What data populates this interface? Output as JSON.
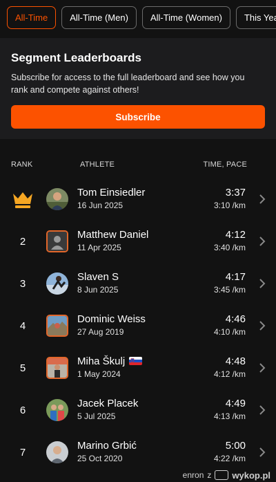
{
  "tabs": [
    {
      "label": "All-Time",
      "active": true
    },
    {
      "label": "All-Time (Men)",
      "active": false
    },
    {
      "label": "All-Time (Women)",
      "active": false
    },
    {
      "label": "This Year",
      "active": false
    }
  ],
  "promo": {
    "title": "Segment Leaderboards",
    "text": "Subscribe for access to the full leaderboard and see how you rank and compete against others!",
    "button_label": "Subscribe"
  },
  "leaderboard": {
    "headers": {
      "rank": "RANK",
      "athlete": "ATHLETE",
      "time": "TIME, PACE"
    },
    "rows": [
      {
        "rank": "1",
        "rank_icon": "crown-icon",
        "name": "Tom Einsiedler",
        "flag": "",
        "date": "16 Jun 2025",
        "time": "3:37",
        "pace": "3:10 /km"
      },
      {
        "rank": "2",
        "name": "Matthew Daniel",
        "flag": "",
        "date": "11 Apr 2025",
        "time": "4:12",
        "pace": "3:40 /km"
      },
      {
        "rank": "3",
        "name": "Slaven S",
        "flag": "",
        "date": "8 Jun 2025",
        "time": "4:17",
        "pace": "3:45 /km"
      },
      {
        "rank": "4",
        "name": "Dominic Weiss",
        "flag": "",
        "date": "27 Aug 2019",
        "time": "4:46",
        "pace": "4:10 /km"
      },
      {
        "rank": "5",
        "name": "Miha Škulj",
        "flag": "slovenia-flag-icon",
        "date": "1 May 2024",
        "time": "4:48",
        "pace": "4:12 /km"
      },
      {
        "rank": "6",
        "name": "Jacek Placek",
        "flag": "",
        "date": "5 Jul 2025",
        "time": "4:49",
        "pace": "4:13 /km"
      },
      {
        "rank": "7",
        "name": "Marino Grbić",
        "flag": "",
        "date": "25 Oct 2020",
        "time": "5:00",
        "pace": "4:22 /km"
      }
    ]
  },
  "watermark": {
    "user": "enron",
    "connector": "z",
    "site": "wykop.pl"
  },
  "colors": {
    "accent": "#fc5200",
    "background": "#121212",
    "card": "#1c1c1e",
    "crown": "#f5a623"
  }
}
